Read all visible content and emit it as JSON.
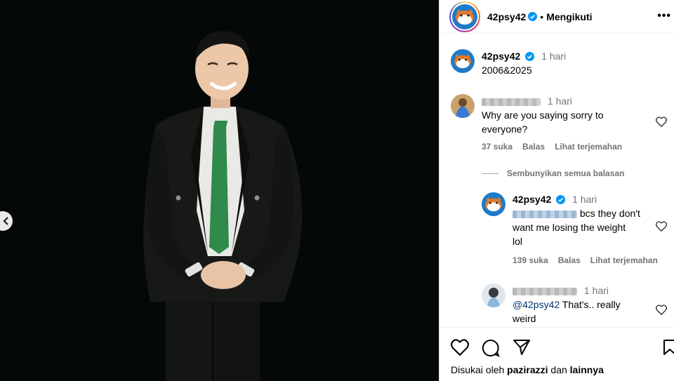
{
  "colors": {
    "link": "#00376b",
    "verified": "#0095f6",
    "muted": "#737373",
    "photo_bg": "#040807",
    "avatar_blue": "#1d7bc9"
  },
  "header": {
    "username": "42psy42",
    "separator": "•",
    "follow_label": "Mengikuti",
    "more_label": "•••"
  },
  "caption": {
    "username": "42psy42",
    "time": "1 hari",
    "text": "2006&2025"
  },
  "comments": [
    {
      "username_hidden": true,
      "time": "1 hari",
      "text_line1": "Why are you saying sorry to",
      "text_line2": "everyone?",
      "likes": "37 suka",
      "reply_label": "Balas",
      "translate_label": "Lihat terjemahan"
    }
  ],
  "hide_replies_label": "Sembunyikan semua balasan",
  "reply": {
    "username": "42psy42",
    "time": "1 hari",
    "text_line1": "bcs they don't",
    "text_line2": "want me losing the weight",
    "text_line3": "lol",
    "likes": "139 suka",
    "reply_label": "Balas",
    "translate_label": "Lihat terjemahan"
  },
  "reply2": {
    "time": "1 hari",
    "mention": "@42psy42",
    "text_line1": " That's.. really",
    "text_line2": "weird"
  },
  "likes_bar": {
    "prefix": "Disukai oleh ",
    "user": "pazirazzi",
    "middle": " dan ",
    "suffix": "lainnya"
  },
  "icons": [
    "chevron-left-icon",
    "verified-badge-icon",
    "heart-icon",
    "comment-icon",
    "share-icon",
    "bookmark-icon"
  ]
}
